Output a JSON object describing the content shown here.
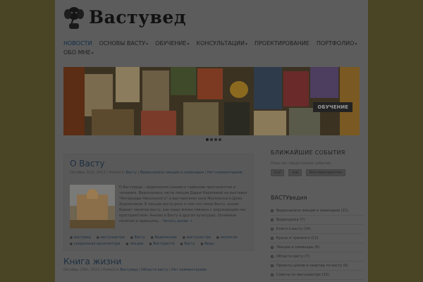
{
  "header": {
    "logo_text": "Вастувед"
  },
  "nav": {
    "row1": [
      {
        "label": "НОВОСТИ",
        "caret": "",
        "active": true
      },
      {
        "label": "ОСНОВЫ ВАСТУ",
        "caret": "▾",
        "active": false
      },
      {
        "label": "ОБУЧЕНИЕ",
        "caret": "▾",
        "active": false
      },
      {
        "label": "КОНСУЛЬТАЦИИ",
        "caret": "▾",
        "active": false
      },
      {
        "label": "ПРОЕКТИРОВАНИЕ",
        "caret": "",
        "active": false
      },
      {
        "label": "ПОРТФОЛИО",
        "caret": "▾",
        "active": false
      }
    ],
    "row2": [
      {
        "label": "ОБО МНЕ",
        "caret": "▾",
        "active": false
      }
    ]
  },
  "slider": {
    "caption": "ОБУЧЕНИЕ",
    "dots": 4,
    "active_dot": 0
  },
  "post1": {
    "title": "О Васту",
    "meta_date": "Октябрь 31st, 2013 | Posted in",
    "meta_cat": "Васту",
    "meta_sep": " | ",
    "meta_cat2": "Видеозаписи лекций и семинаров",
    "meta_comments": "Нет комментариев",
    "excerpt": "О Вастуведе – ведическом знании о гармонии пространства и человека. Видеозапись части лекции Дарьи Кириловой на выставке \"Интерьеры Никольского\" в выставочном зале Московского Дома Художников. В лекции васту речь о том что такое Васту, каким бывает понятие васту, как наше жилье связано с окружающим нас пространством. Анализ в Васту в других культурах. Основные понятия и принципы…",
    "read_more": "Читать далее →",
    "tags": [
      "вастувед",
      "вастушастра",
      "Васту",
      "Ведические",
      "вастушастра",
      "экология",
      "сакральная архитектура",
      "лекции",
      "Вастурасти",
      "Васту",
      "Веды"
    ]
  },
  "post2": {
    "title": "Книга жизни",
    "meta_date": "Октябрь 29th, 2013 | Posted in",
    "meta_cat": "Вастувед",
    "meta_cat2": "Области васту",
    "meta_comments": "Нет комментариев"
  },
  "sidebar": {
    "events_title": "БЛИЖАЙШИЕ СОБЫТИЯ",
    "events_note": "Пока нет предстоящих событий.",
    "events_btns": [
      "iCal",
      "Ical",
      "Все мероприятия"
    ],
    "cats_title": "ВАСТУведия",
    "categories": [
      "Видеозаписи лекций и семинаров (21)",
      "Видеоуроки (7)",
      "Книги о васту (14)",
      "Курсы и тренинги (12)",
      "Лекции и семинары (8)",
      "Области васту (7)",
      "Проекты домов и квартир по васту (6)",
      "Советы по вастушастре (15)",
      "Статьи о васту (21)"
    ]
  },
  "colors": {
    "background": "#4a4525",
    "page": "#5c5c5c",
    "accent": "#0f2c4a"
  }
}
